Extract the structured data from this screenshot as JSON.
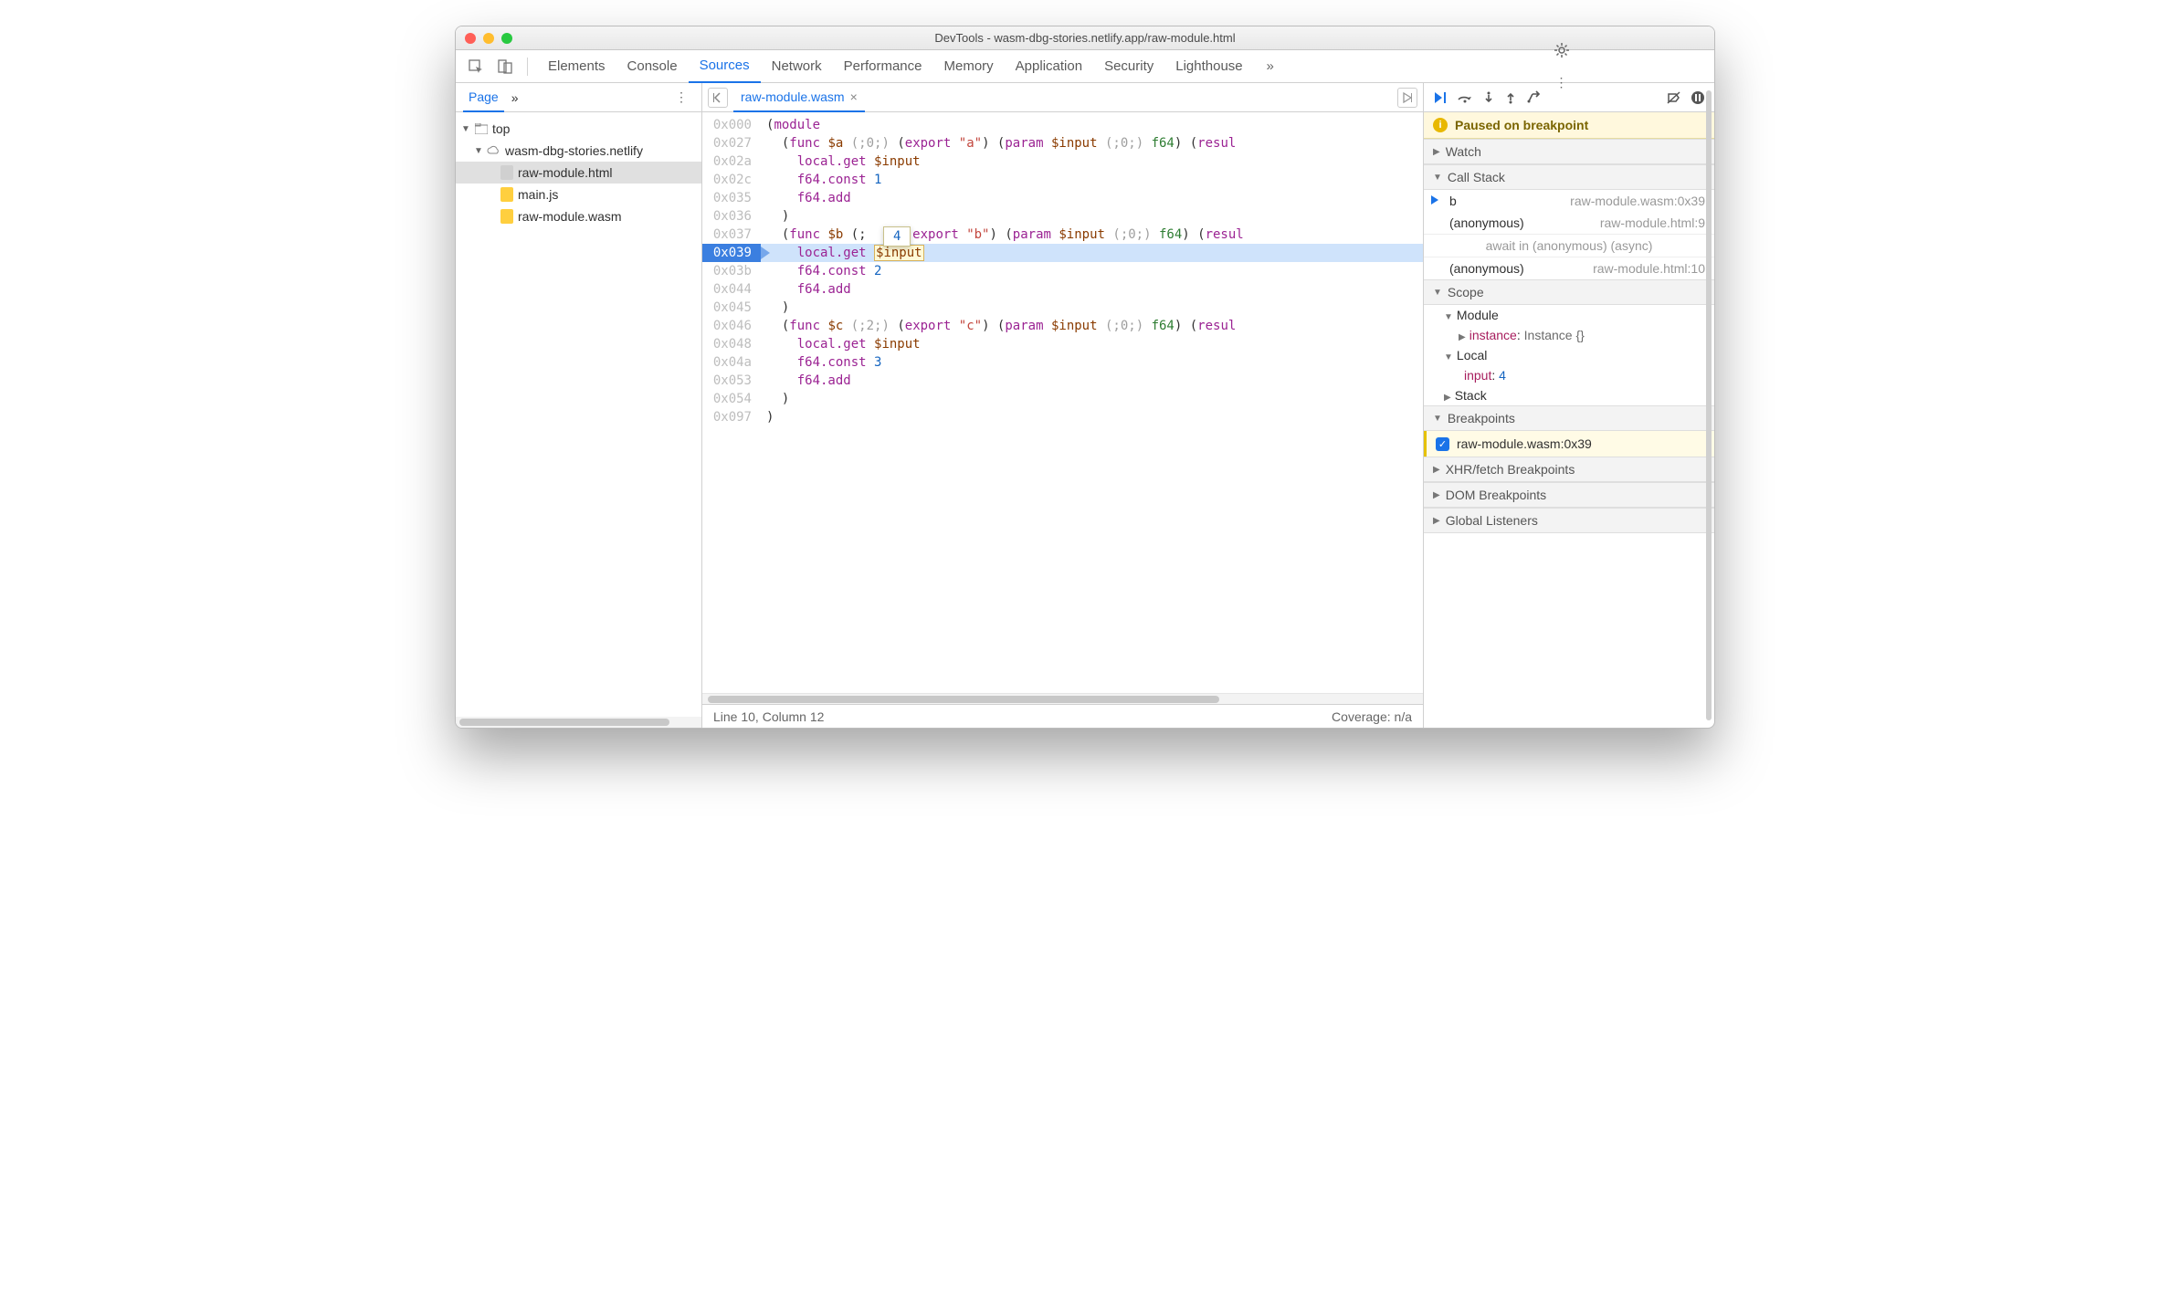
{
  "window_title": "DevTools - wasm-dbg-stories.netlify.app/raw-module.html",
  "tabs": [
    "Elements",
    "Console",
    "Sources",
    "Network",
    "Performance",
    "Memory",
    "Application",
    "Security",
    "Lighthouse"
  ],
  "active_tab": "Sources",
  "nav": {
    "page_tab": "Page",
    "top": "top",
    "origin": "wasm-dbg-stories.netlify",
    "files": [
      "raw-module.html",
      "main.js",
      "raw-module.wasm"
    ]
  },
  "editor": {
    "file_tab": "raw-module.wasm",
    "status_left": "Line 10, Column 12",
    "status_right": "Coverage: n/a",
    "hover_value": "4",
    "lines": [
      {
        "addr": "0x000",
        "indent": 0,
        "tokens": [
          {
            "c": "tok-plain",
            "t": "("
          },
          {
            "c": "tok-kw",
            "t": "module"
          }
        ]
      },
      {
        "addr": "0x027",
        "indent": 1,
        "tokens": [
          {
            "c": "tok-plain",
            "t": "("
          },
          {
            "c": "tok-kw",
            "t": "func"
          },
          {
            "c": "tok-plain",
            "t": " "
          },
          {
            "c": "tok-id",
            "t": "$a"
          },
          {
            "c": "tok-plain",
            "t": " "
          },
          {
            "c": "tok-comment",
            "t": "(;0;)"
          },
          {
            "c": "tok-plain",
            "t": " ("
          },
          {
            "c": "tok-kw",
            "t": "export"
          },
          {
            "c": "tok-plain",
            "t": " "
          },
          {
            "c": "tok-str",
            "t": "\"a\""
          },
          {
            "c": "tok-plain",
            "t": ") ("
          },
          {
            "c": "tok-kw",
            "t": "param"
          },
          {
            "c": "tok-plain",
            "t": " "
          },
          {
            "c": "tok-id",
            "t": "$input"
          },
          {
            "c": "tok-plain",
            "t": " "
          },
          {
            "c": "tok-comment",
            "t": "(;0;)"
          },
          {
            "c": "tok-plain",
            "t": " "
          },
          {
            "c": "tok-type",
            "t": "f64"
          },
          {
            "c": "tok-plain",
            "t": ") ("
          },
          {
            "c": "tok-kw",
            "t": "resul"
          }
        ]
      },
      {
        "addr": "0x02a",
        "indent": 2,
        "tokens": [
          {
            "c": "tok-kw",
            "t": "local.get"
          },
          {
            "c": "tok-plain",
            "t": " "
          },
          {
            "c": "tok-id",
            "t": "$input"
          }
        ]
      },
      {
        "addr": "0x02c",
        "indent": 2,
        "tokens": [
          {
            "c": "tok-kw",
            "t": "f64.const"
          },
          {
            "c": "tok-plain",
            "t": " "
          },
          {
            "c": "tok-num",
            "t": "1"
          }
        ]
      },
      {
        "addr": "0x035",
        "indent": 2,
        "tokens": [
          {
            "c": "tok-kw",
            "t": "f64.add"
          }
        ]
      },
      {
        "addr": "0x036",
        "indent": 1,
        "tokens": [
          {
            "c": "tok-plain",
            "t": ")"
          }
        ]
      },
      {
        "addr": "0x037",
        "indent": 1,
        "tokens": [
          {
            "c": "tok-plain",
            "t": "("
          },
          {
            "c": "tok-kw",
            "t": "func"
          },
          {
            "c": "tok-plain",
            "t": " "
          },
          {
            "c": "tok-id",
            "t": "$b"
          },
          {
            "c": "tok-plain",
            "t": " (;   ) ("
          },
          {
            "c": "tok-kw",
            "t": "export"
          },
          {
            "c": "tok-plain",
            "t": " "
          },
          {
            "c": "tok-str",
            "t": "\"b\""
          },
          {
            "c": "tok-plain",
            "t": ") ("
          },
          {
            "c": "tok-kw",
            "t": "param"
          },
          {
            "c": "tok-plain",
            "t": " "
          },
          {
            "c": "tok-id",
            "t": "$input"
          },
          {
            "c": "tok-plain",
            "t": " "
          },
          {
            "c": "tok-comment",
            "t": "(;0;)"
          },
          {
            "c": "tok-plain",
            "t": " "
          },
          {
            "c": "tok-type",
            "t": "f64"
          },
          {
            "c": "tok-plain",
            "t": ") ("
          },
          {
            "c": "tok-kw",
            "t": "resul"
          }
        ]
      },
      {
        "addr": "0x039",
        "indent": 2,
        "current": true,
        "tokens": [
          {
            "c": "tok-kw",
            "t": "local.get"
          },
          {
            "c": "tok-plain",
            "t": " "
          },
          {
            "c": "tok-id tok-hl",
            "t": "$input"
          }
        ]
      },
      {
        "addr": "0x03b",
        "indent": 2,
        "tokens": [
          {
            "c": "tok-kw",
            "t": "f64.const"
          },
          {
            "c": "tok-plain",
            "t": " "
          },
          {
            "c": "tok-num",
            "t": "2"
          }
        ]
      },
      {
        "addr": "0x044",
        "indent": 2,
        "tokens": [
          {
            "c": "tok-kw",
            "t": "f64.add"
          }
        ]
      },
      {
        "addr": "0x045",
        "indent": 1,
        "tokens": [
          {
            "c": "tok-plain",
            "t": ")"
          }
        ]
      },
      {
        "addr": "0x046",
        "indent": 1,
        "tokens": [
          {
            "c": "tok-plain",
            "t": "("
          },
          {
            "c": "tok-kw",
            "t": "func"
          },
          {
            "c": "tok-plain",
            "t": " "
          },
          {
            "c": "tok-id",
            "t": "$c"
          },
          {
            "c": "tok-plain",
            "t": " "
          },
          {
            "c": "tok-comment",
            "t": "(;2;)"
          },
          {
            "c": "tok-plain",
            "t": " ("
          },
          {
            "c": "tok-kw",
            "t": "export"
          },
          {
            "c": "tok-plain",
            "t": " "
          },
          {
            "c": "tok-str",
            "t": "\"c\""
          },
          {
            "c": "tok-plain",
            "t": ") ("
          },
          {
            "c": "tok-kw",
            "t": "param"
          },
          {
            "c": "tok-plain",
            "t": " "
          },
          {
            "c": "tok-id",
            "t": "$input"
          },
          {
            "c": "tok-plain",
            "t": " "
          },
          {
            "c": "tok-comment",
            "t": "(;0;)"
          },
          {
            "c": "tok-plain",
            "t": " "
          },
          {
            "c": "tok-type",
            "t": "f64"
          },
          {
            "c": "tok-plain",
            "t": ") ("
          },
          {
            "c": "tok-kw",
            "t": "resul"
          }
        ]
      },
      {
        "addr": "0x048",
        "indent": 2,
        "tokens": [
          {
            "c": "tok-kw",
            "t": "local.get"
          },
          {
            "c": "tok-plain",
            "t": " "
          },
          {
            "c": "tok-id",
            "t": "$input"
          }
        ]
      },
      {
        "addr": "0x04a",
        "indent": 2,
        "tokens": [
          {
            "c": "tok-kw",
            "t": "f64.const"
          },
          {
            "c": "tok-plain",
            "t": " "
          },
          {
            "c": "tok-num",
            "t": "3"
          }
        ]
      },
      {
        "addr": "0x053",
        "indent": 2,
        "tokens": [
          {
            "c": "tok-kw",
            "t": "f64.add"
          }
        ]
      },
      {
        "addr": "0x054",
        "indent": 1,
        "tokens": [
          {
            "c": "tok-plain",
            "t": ")"
          }
        ]
      },
      {
        "addr": "0x097",
        "indent": 0,
        "tokens": [
          {
            "c": "tok-plain",
            "t": ")"
          }
        ]
      }
    ]
  },
  "debugger": {
    "paused_msg": "Paused on breakpoint",
    "sections": {
      "watch": "Watch",
      "callstack": "Call Stack",
      "scope": "Scope",
      "breakpoints": "Breakpoints",
      "xhr": "XHR/fetch Breakpoints",
      "dom": "DOM Breakpoints",
      "global": "Global Listeners"
    },
    "callstack": [
      {
        "name": "b",
        "loc": "raw-module.wasm:0x39",
        "current": true
      },
      {
        "name": "(anonymous)",
        "loc": "raw-module.html:9"
      }
    ],
    "async_label": "await in (anonymous) (async)",
    "callstack_after": [
      {
        "name": "(anonymous)",
        "loc": "raw-module.html:10"
      }
    ],
    "scope": {
      "module_label": "Module",
      "module_prop": "instance",
      "module_val": "Instance {}",
      "local_label": "Local",
      "local_prop": "input",
      "local_val": "4",
      "stack_label": "Stack"
    },
    "breakpoints": [
      {
        "label": "raw-module.wasm:0x39",
        "checked": true
      }
    ]
  }
}
